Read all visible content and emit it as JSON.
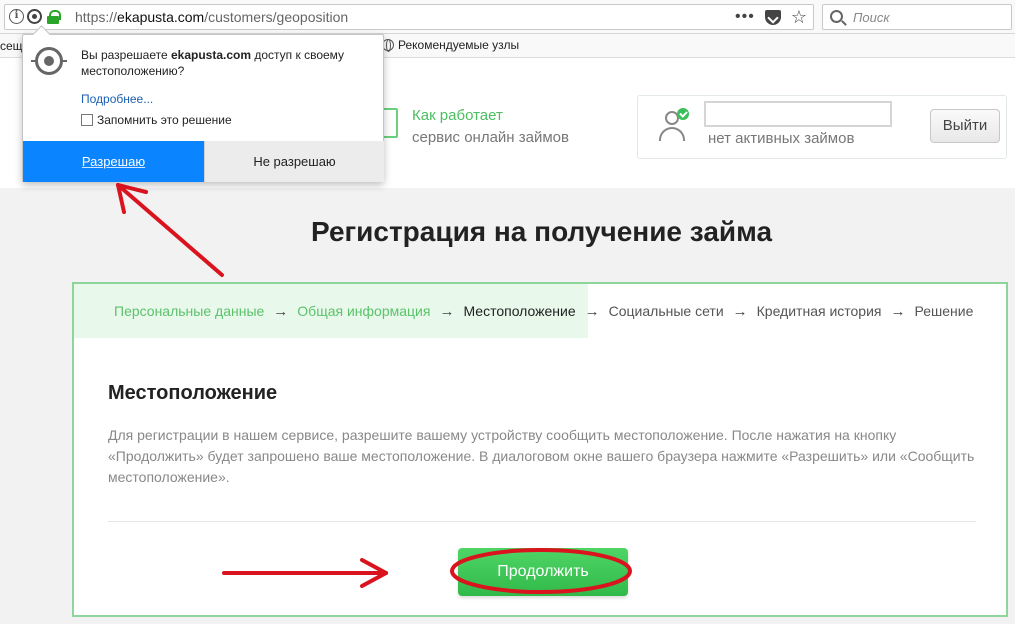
{
  "browser": {
    "url_prefix": "https://",
    "url_host": "ekapusta.com",
    "url_path": "/customers/geoposition",
    "search_placeholder": "Поиск",
    "bookmarks_partial": "сещ",
    "bookmark_recommended": "Рекомендуемые узлы",
    "menu_dots": "•••",
    "star": "☆"
  },
  "popup": {
    "message_prefix": "Вы разрешаете ",
    "message_host": "ekapusta.com",
    "message_suffix": " доступ к своему местоположению?",
    "more_link": "Подробнее...",
    "remember_label": "Запомнить это решение",
    "allow_label": "Разрешаю",
    "deny_label": "Не разрешаю"
  },
  "header": {
    "how_title": "Как работает",
    "how_subtitle": "сервис онлайн займов",
    "no_loans": "нет активных займов",
    "logout_label": "Выйти"
  },
  "page": {
    "title": "Регистрация на получение займа"
  },
  "steps": [
    {
      "label": "Персональные данные",
      "state": "done"
    },
    {
      "label": "Общая информация",
      "state": "done"
    },
    {
      "label": "Местоположение",
      "state": "active"
    },
    {
      "label": "Социальные сети",
      "state": "pending"
    },
    {
      "label": "Кредитная история",
      "state": "pending"
    },
    {
      "label": "Решение",
      "state": "pending"
    }
  ],
  "step_arrow": "→",
  "section": {
    "title": "Местоположение",
    "description": "Для регистрации в нашем сервисе, разрешите вашему устройству сообщить местоположение. После нажатия на кнопку «Продолжить» будет запрошено ваше местоположение. В диалоговом окне вашего браузера нажмите «Разрешить» или «Сообщить местоположение».",
    "continue_label": "Продолжить"
  },
  "colors": {
    "accent_green": "#3cbf5a",
    "allow_blue": "#0a84ff",
    "annotation_red": "#d9141e"
  }
}
